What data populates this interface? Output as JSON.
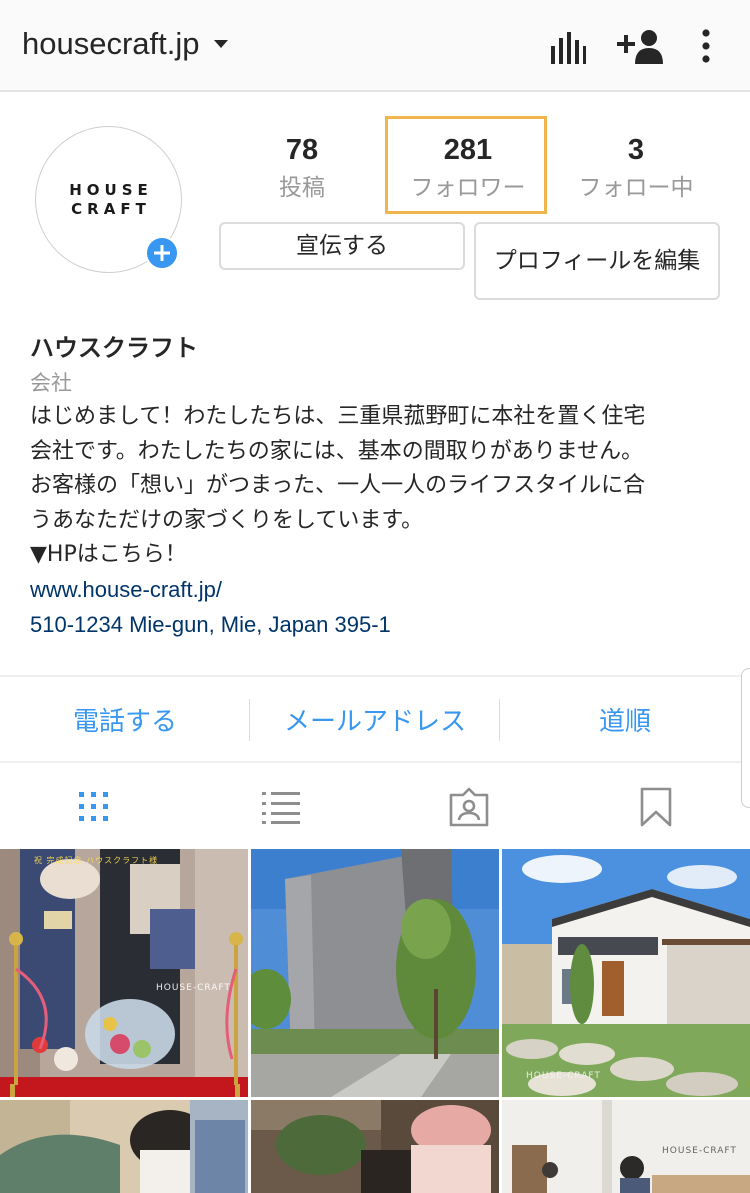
{
  "header": {
    "username": "housecraft.jp",
    "icons": [
      "chevron-down-icon",
      "insights-icon",
      "add-person-icon",
      "more-vertical-icon"
    ]
  },
  "profile": {
    "avatar_logo": [
      "HOUSE",
      "CRAFT"
    ],
    "stats": [
      {
        "value": "78",
        "label": "投稿"
      },
      {
        "value": "281",
        "label": "フォロワー"
      },
      {
        "value": "3",
        "label": "フォロー中"
      }
    ],
    "buttons": {
      "promote": "宣伝する",
      "edit_profile": "プロフィールを編集"
    }
  },
  "bio": {
    "name": "ハウスクラフト",
    "category": "会社",
    "lines": [
      "はじめまして！わたしたちは、三重県菰野町に本社を置く住宅",
      "会社です。わたしたちの家には、基本の間取りがありません。",
      "お客様の「想い」がつまった、一人一人のライフスタイルに合",
      "うあなただけの家づくりをしています。",
      "▼HPはこちら！"
    ],
    "website": "www.house-craft.jp/",
    "address": "510-1234 Mie-gun, Mie, Japan 395-1"
  },
  "contact": {
    "call": "電話する",
    "email": "メールアドレス",
    "directions": "道順"
  },
  "tabs": [
    "grid-icon",
    "list-icon",
    "tagged-icon",
    "saved-icon"
  ],
  "posts": {
    "watermark": "HOUSE-CRAFT",
    "sign_text": "祝 完成記念 ハウスクラフト様"
  },
  "colors": {
    "accent": "#3897f0",
    "link": "#003569",
    "highlight": "#f0b54d"
  }
}
